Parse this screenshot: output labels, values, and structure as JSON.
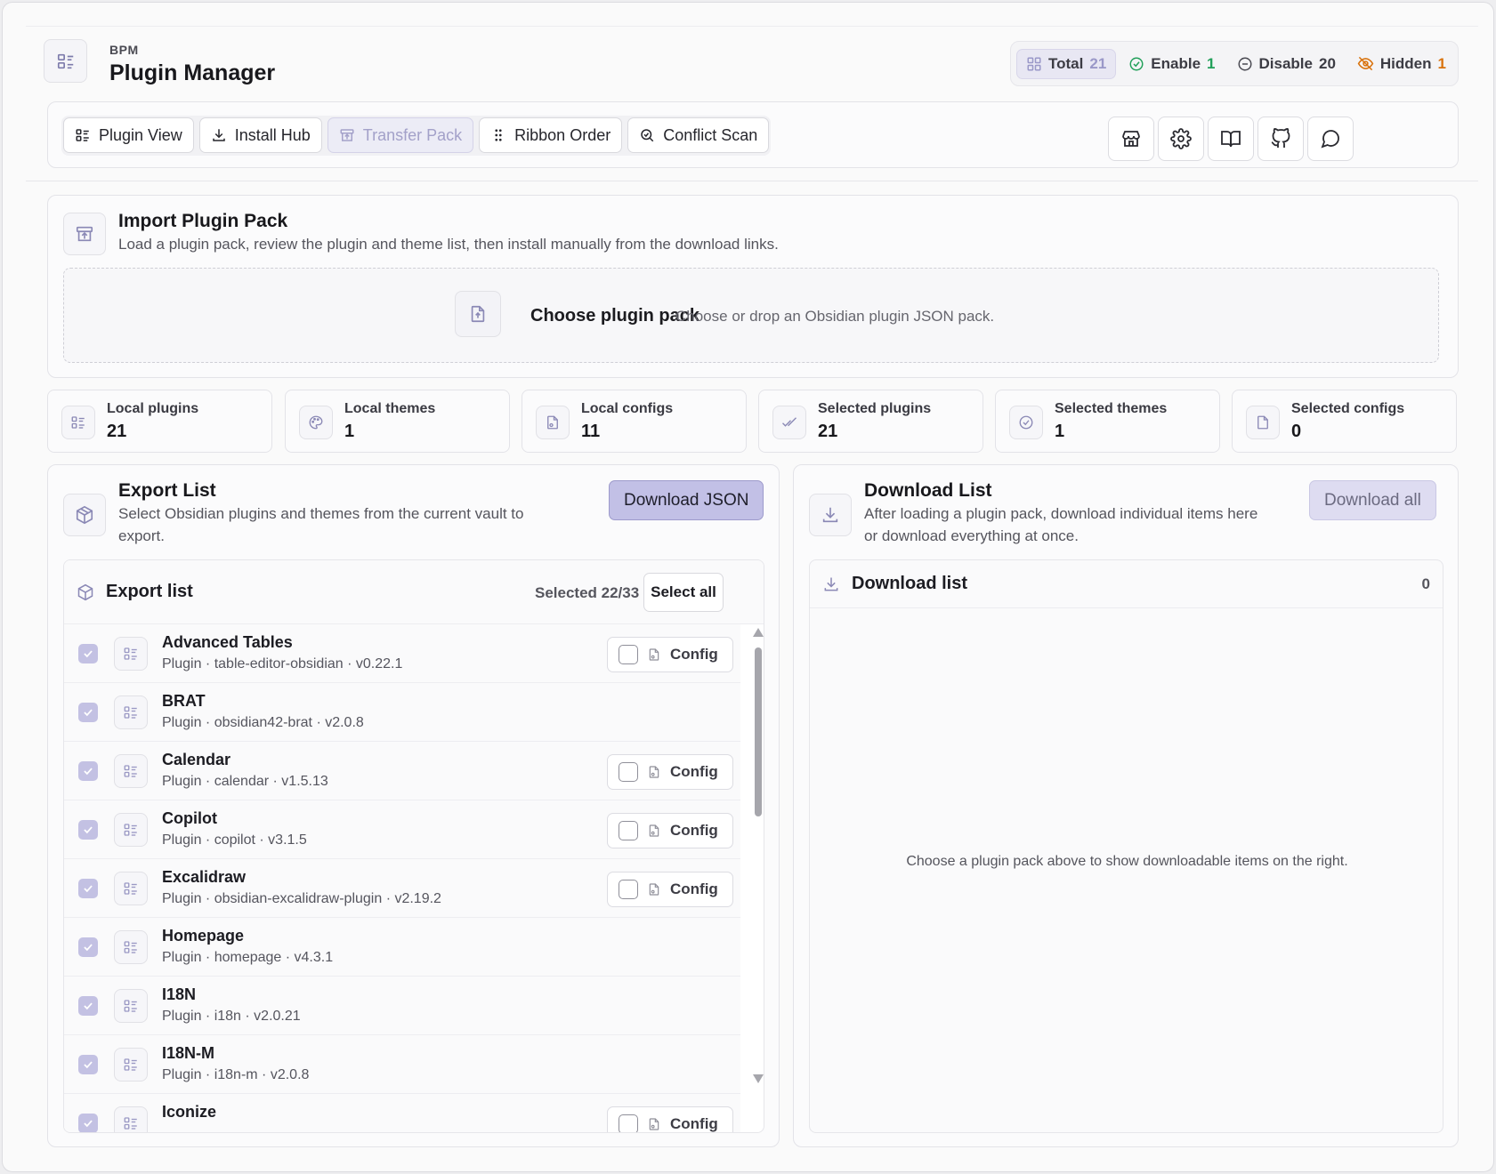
{
  "header": {
    "eyebrow": "BPM",
    "title": "Plugin Manager",
    "stats": {
      "total_label": "Total",
      "total_value": "21",
      "enable_label": "Enable",
      "enable_value": "1",
      "disable_label": "Disable",
      "disable_value": "20",
      "hidden_label": "Hidden",
      "hidden_value": "1"
    },
    "stat_colors": {
      "total": "#9a98c8",
      "enable": "#22a05a",
      "disable": "#3c3c44",
      "hidden": "#d9730d"
    }
  },
  "toolbar": {
    "buttons": [
      {
        "label": "Plugin View",
        "icon": "list-icon"
      },
      {
        "label": "Install Hub",
        "icon": "download-icon"
      },
      {
        "label": "Transfer Pack",
        "icon": "archive-icon",
        "active": true
      },
      {
        "label": "Ribbon Order",
        "icon": "grip-icon"
      },
      {
        "label": "Conflict Scan",
        "icon": "search-check-icon"
      }
    ],
    "icon_buttons": [
      "store-icon",
      "gear-icon",
      "book-icon",
      "github-icon",
      "chat-icon"
    ]
  },
  "import": {
    "title": "Import Plugin Pack",
    "desc": "Load a plugin pack, review the plugin and theme list, then install manually from the download links.",
    "drop_title": "Choose plugin pack",
    "drop_desc": "Choose or drop an Obsidian plugin JSON pack."
  },
  "stat_cards": [
    {
      "label": "Local plugins",
      "value": "21",
      "icon": "list-icon"
    },
    {
      "label": "Local themes",
      "value": "1",
      "icon": "palette-icon"
    },
    {
      "label": "Local configs",
      "value": "11",
      "icon": "file-config-icon"
    },
    {
      "label": "Selected plugins",
      "value": "21",
      "icon": "check-check-icon"
    },
    {
      "label": "Selected themes",
      "value": "1",
      "icon": "check-circle-icon"
    },
    {
      "label": "Selected configs",
      "value": "0",
      "icon": "file-icon"
    }
  ],
  "export": {
    "title": "Export List",
    "desc_line1": "Select Obsidian plugins and themes from the current vault to",
    "desc_line2": "export.",
    "download_btn": "Download JSON",
    "list_title": "Export list",
    "selected_text": "Selected 22/33",
    "select_all": "Select all",
    "config_label": "Config",
    "items": [
      {
        "name": "Advanced Tables",
        "sub": "Plugin · table-editor-obsidian · v0.22.1",
        "config": true
      },
      {
        "name": "BRAT",
        "sub": "Plugin · obsidian42-brat · v2.0.8",
        "config": false
      },
      {
        "name": "Calendar",
        "sub": "Plugin · calendar · v1.5.13",
        "config": true
      },
      {
        "name": "Copilot",
        "sub": "Plugin · copilot · v3.1.5",
        "config": true
      },
      {
        "name": "Excalidraw",
        "sub": "Plugin · obsidian-excalidraw-plugin · v2.19.2",
        "config": true
      },
      {
        "name": "Homepage",
        "sub": "Plugin · homepage · v4.3.1",
        "config": false
      },
      {
        "name": "I18N",
        "sub": "Plugin · i18n · v2.0.21",
        "config": false
      },
      {
        "name": "I18N-M",
        "sub": "Plugin · i18n-m · v2.0.8",
        "config": false
      },
      {
        "name": "Iconize",
        "sub": "",
        "config": true
      }
    ]
  },
  "download": {
    "title": "Download List",
    "desc_line1": "After loading a plugin pack, download individual items here",
    "desc_line2": "or download everything at once.",
    "download_all": "Download all",
    "list_title": "Download list",
    "count": "0",
    "empty": "Choose a plugin pack above to show downloadable items on the right."
  }
}
